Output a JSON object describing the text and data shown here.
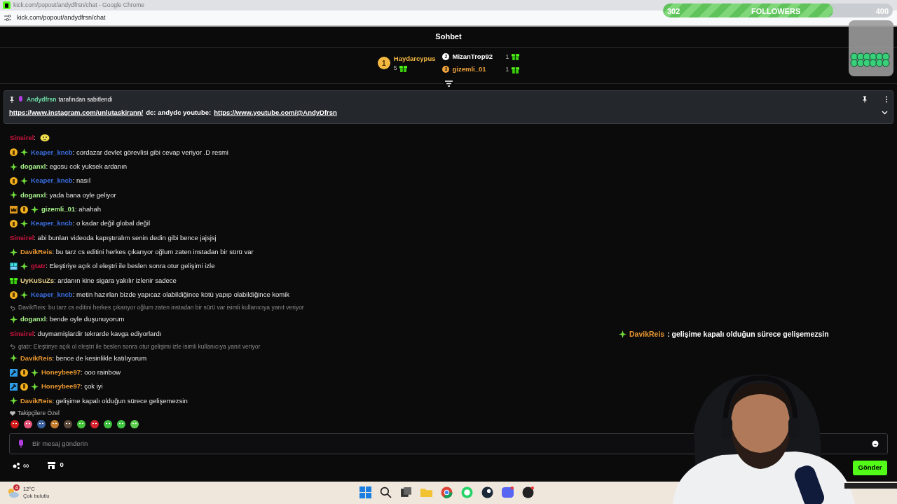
{
  "browser": {
    "title": "kick.com/popout/andydfrsn/chat - Google Chrome",
    "url": "kick.com/popout/andydfrsn/chat"
  },
  "followers_goal": {
    "current": "302",
    "label": "FOLLOWERS",
    "target": "400",
    "level": 0.74
  },
  "chat_header": {
    "title": "Sohbet"
  },
  "leaderboard": [
    {
      "rank": "1",
      "name": "Haydarcypus",
      "count": "5",
      "color": "#f5b942"
    },
    {
      "rank": "2",
      "name": "MizanTrop92",
      "count": "1",
      "color": "#ffffff"
    },
    {
      "rank": "3",
      "name": "gizemli_01",
      "count": "1",
      "color": "#f0a33a"
    }
  ],
  "pinned": {
    "author": "Andydfrsn",
    "suffix": "tarafından sabitlendi",
    "parts": [
      {
        "kind": "link",
        "text": "https://www.instagram.com/unlutaskirann/"
      },
      {
        "kind": "text",
        "text": "dc: andydc youtube:"
      },
      {
        "kind": "link",
        "text": "https://www.youtube.com/@AndyDfrsn"
      }
    ]
  },
  "messages": [
    {
      "kind": "emote",
      "user": "Sinsirel",
      "color": "#d0143f",
      "text": ":"
    },
    {
      "kind": "message",
      "badges": [
        {
          "kind": "sub"
        },
        {
          "kind": "verified"
        }
      ],
      "user": "Keaper_kncb",
      "color": "#3b6fe0",
      "text": ": cordazar devlet görevlisi gibi cevap veriyor .D resmi"
    },
    {
      "kind": "message",
      "badges": [
        {
          "kind": "verified"
        }
      ],
      "user": "doganxl",
      "color": "#a6f08a",
      "text": ": egosu cok yuksek ardanın"
    },
    {
      "kind": "message",
      "badges": [
        {
          "kind": "sub"
        },
        {
          "kind": "verified"
        }
      ],
      "user": "Keaper_kncb",
      "color": "#3b6fe0",
      "text": ": nasıl"
    },
    {
      "kind": "message",
      "badges": [
        {
          "kind": "verified"
        }
      ],
      "user": "doganxl",
      "color": "#a6f08a",
      "text": ": yada bana oyle geliyor"
    },
    {
      "kind": "message",
      "badges": [
        {
          "kind": "crown"
        },
        {
          "kind": "sub"
        },
        {
          "kind": "verified"
        }
      ],
      "user": "gizemli_01",
      "color": "#a6f08a",
      "text": ": ahahah"
    },
    {
      "kind": "message",
      "badges": [
        {
          "kind": "sub"
        },
        {
          "kind": "verified"
        }
      ],
      "user": "Keaper_kncb",
      "color": "#3b6fe0",
      "text": ": o kadar değil global değil"
    },
    {
      "kind": "message",
      "user": "Sinsirel",
      "color": "#d0143f",
      "text": ": abi bunları videoda kapıştıralım senin dedin gibi bence jajsjsj"
    },
    {
      "kind": "message",
      "badges": [
        {
          "kind": "verified"
        }
      ],
      "user": "DavikReis",
      "color": "#e8962e",
      "text": ": bu tarz cs editini herkes çıkarıyor oğlum zaten instadan bir sürü var"
    },
    {
      "kind": "message",
      "badges": [
        {
          "kind": "og"
        },
        {
          "kind": "verified"
        }
      ],
      "user": "gtatr",
      "color": "#d0143f",
      "text": ": Eleştiriye açık ol eleştri ile beslen sonra otur gelişimi izle"
    },
    {
      "kind": "message",
      "badges": [
        {
          "kind": "gift"
        }
      ],
      "user": "UyKuSuZs",
      "color": "#e8d28a",
      "text": ": ardanın kine sigara yakılır izlenir sadece"
    },
    {
      "kind": "message",
      "badges": [
        {
          "kind": "sub"
        },
        {
          "kind": "verified"
        }
      ],
      "user": "Keaper_kncb",
      "color": "#3b6fe0",
      "text": ": metin hazırlan bizde yapıcaz olabildiğince kötü yapıp olabildiğince komik"
    },
    {
      "kind": "reply",
      "text": "DavikReis: bu tarz cs editini herkes çıkarıyor oğlum zaten instadan bir sürü var isimli kullanıcıya yanıt veriyor"
    },
    {
      "kind": "message",
      "badges": [
        {
          "kind": "verified"
        }
      ],
      "user": "doganxl",
      "color": "#a6f08a",
      "text": ": bende oyle duşunuyorum"
    },
    {
      "kind": "message",
      "user": "Sinsirel",
      "color": "#d0143f",
      "text": ": duymamişlardir tekrarde kavga ediyorlardı"
    },
    {
      "kind": "reply",
      "text": "gtatr: Eleştiriye açık ol eleştri ile beslen sonra otur gelişimi izle isimli kullanıcıya yanıt veriyor"
    },
    {
      "kind": "message",
      "badges": [
        {
          "kind": "verified"
        }
      ],
      "user": "DavikReis",
      "color": "#e8962e",
      "text": ": bence de kesinlikle katılıyorum"
    },
    {
      "kind": "message",
      "badges": [
        {
          "kind": "mod"
        },
        {
          "kind": "sub"
        },
        {
          "kind": "verified"
        }
      ],
      "user": "Honeybee97",
      "color": "#e8962e",
      "text": ": ooo rainbow"
    },
    {
      "kind": "message",
      "badges": [
        {
          "kind": "mod"
        },
        {
          "kind": "sub"
        },
        {
          "kind": "verified"
        }
      ],
      "user": "Honeybee97",
      "color": "#e8962e",
      "text": ": çok iyi"
    },
    {
      "kind": "message",
      "badges": [
        {
          "kind": "verified"
        }
      ],
      "user": "DavikReis",
      "color": "#e8962e",
      "text": ": gelişime kapalı olduğun sürece gelişemezsin"
    }
  ],
  "overlay_message": {
    "user": "DavikReis",
    "color": "#e8962e",
    "text": ": gelişime kapalı olduğun sürece gelişemezsin"
  },
  "emote_section": {
    "label": "Takipçilere Özel"
  },
  "input": {
    "placeholder": "Bir mesaj gönderin"
  },
  "footer": {
    "points": "∞",
    "store": "0",
    "send": "Gönder"
  },
  "taskbar": {
    "weather_badge": "4",
    "temperature": "12°C",
    "condition": "Çok bulutlu"
  }
}
